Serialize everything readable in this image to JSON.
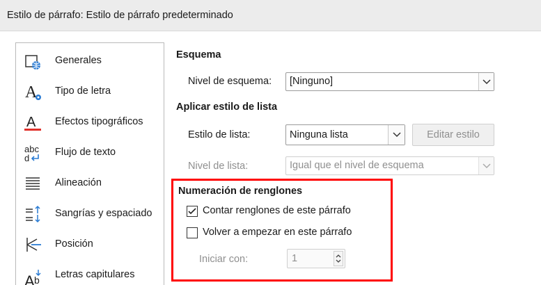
{
  "window": {
    "title": "Estilo de párrafo: Estilo de párrafo predeterminado"
  },
  "sidebar": {
    "items": [
      {
        "label": "Generales",
        "icon": "general-settings-icon"
      },
      {
        "label": "Tipo de letra",
        "icon": "font-icon"
      },
      {
        "label": "Efectos tipográficos",
        "icon": "font-effects-icon"
      },
      {
        "label": "Flujo de texto",
        "icon": "text-flow-icon"
      },
      {
        "label": "Alineación",
        "icon": "alignment-icon"
      },
      {
        "label": "Sangrías y espaciado",
        "icon": "indents-spacing-icon"
      },
      {
        "label": "Posición",
        "icon": "position-icon"
      },
      {
        "label": "Letras capitulares",
        "icon": "drop-caps-icon"
      }
    ]
  },
  "outline": {
    "heading": "Esquema",
    "level_label": "Nivel de esquema:",
    "level_value": "[Ninguno]"
  },
  "list_style": {
    "heading": "Aplicar estilo de lista",
    "style_label": "Estilo de lista:",
    "style_value": "Ninguna lista",
    "edit_button": "Editar estilo",
    "level_label": "Nivel de lista:",
    "level_value": "Igual que el nivel de esquema"
  },
  "line_numbering": {
    "heading": "Numeración de renglones",
    "count_label": "Contar renglones de este párrafo",
    "count_checked": true,
    "restart_label": "Volver a empezar en este párrafo",
    "restart_checked": false,
    "start_label": "Iniciar con:",
    "start_value": "1",
    "highlight_color": "#ff0000"
  }
}
